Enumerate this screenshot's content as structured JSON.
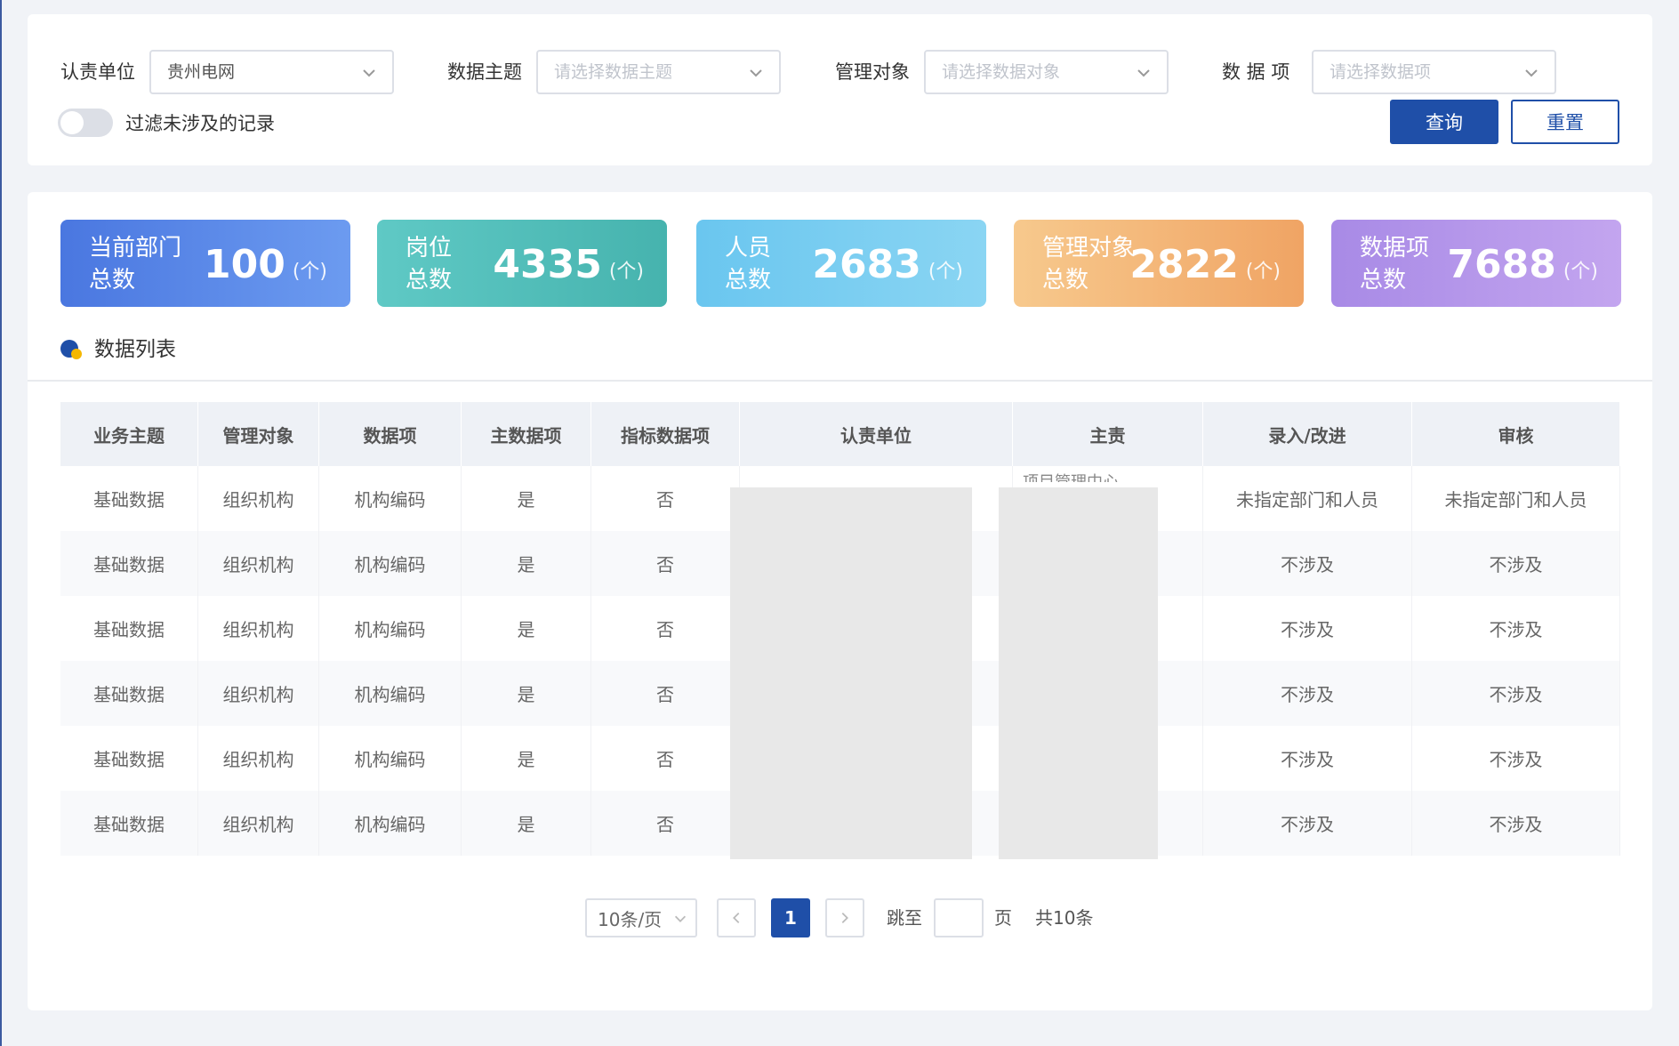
{
  "filters": {
    "unit_label": "认责单位",
    "unit_value": "贵州电网",
    "theme_label": "数据主题",
    "theme_placeholder": "请选择数据主题",
    "object_label": "管理对象",
    "object_placeholder": "请选择数据对象",
    "item_label": "数 据 项",
    "item_placeholder": "请选择数据项",
    "toggle_label": "过滤未涉及的记录",
    "toggle_on": false,
    "query_label": "查询",
    "reset_label": "重置"
  },
  "stats": [
    {
      "label_line1": "当前部门",
      "label_line2": "总数",
      "value": "100",
      "unit": "(个)"
    },
    {
      "label_line1": "岗位",
      "label_line2": "总数",
      "value": "4335",
      "unit": "(个)"
    },
    {
      "label_line1": "人员",
      "label_line2": "总数",
      "value": "2683",
      "unit": "(个)"
    },
    {
      "label_line1": "管理对象",
      "label_line2": "总数",
      "value": "2822",
      "unit": "(个)"
    },
    {
      "label_line1": "数据项",
      "label_line2": "总数",
      "value": "7688",
      "unit": "(个)"
    }
  ],
  "section_title": "数据列表",
  "table": {
    "columns": [
      "业务主题",
      "管理对象",
      "数据项",
      "主数据项",
      "指标数据项",
      "认责单位",
      "主责",
      "录入/改进",
      "审核"
    ],
    "peek_text": "项目管理中心",
    "rows": [
      [
        "基础数据",
        "组织机构",
        "机构编码",
        "是",
        "否",
        "",
        "",
        "未指定部门和人员",
        "未指定部门和人员"
      ],
      [
        "基础数据",
        "组织机构",
        "机构编码",
        "是",
        "否",
        "",
        "",
        "不涉及",
        "不涉及"
      ],
      [
        "基础数据",
        "组织机构",
        "机构编码",
        "是",
        "否",
        "",
        "",
        "不涉及",
        "不涉及"
      ],
      [
        "基础数据",
        "组织机构",
        "机构编码",
        "是",
        "否",
        "",
        "",
        "不涉及",
        "不涉及"
      ],
      [
        "基础数据",
        "组织机构",
        "机构编码",
        "是",
        "否",
        "",
        "",
        "不涉及",
        "不涉及"
      ],
      [
        "基础数据",
        "组织机构",
        "机构编码",
        "是",
        "否",
        "",
        "",
        "不涉及",
        "不涉及"
      ]
    ]
  },
  "pagination": {
    "page_size": "10条/页",
    "current_page": "1",
    "jump_label": "跳至",
    "page_suffix": "页",
    "total": "共10条"
  },
  "colors": {
    "primary": "#1f4fa8",
    "accent_dot": "#f5b700"
  }
}
